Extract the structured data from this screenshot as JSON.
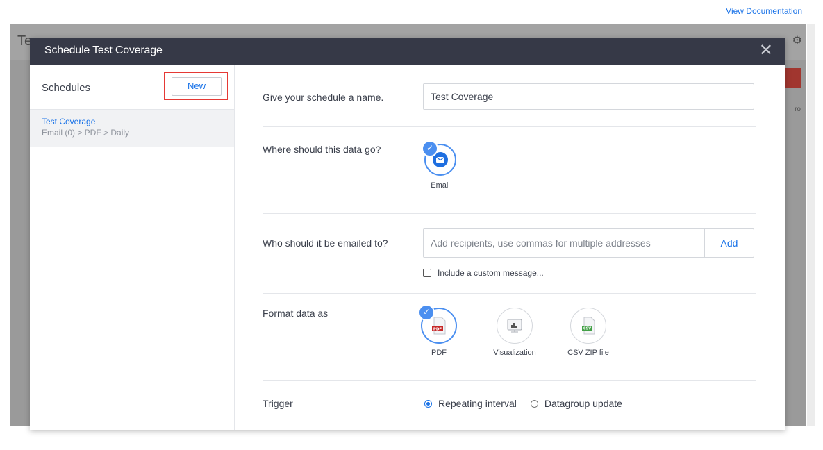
{
  "top_link": "View Documentation",
  "background": {
    "title_fragment": "Te",
    "side_fragment": "ro"
  },
  "modal": {
    "title": "Schedule Test Coverage",
    "close_symbol": "✕"
  },
  "sidebar": {
    "title": "Schedules",
    "new_button": "New",
    "schedules": [
      {
        "name": "Test Coverage",
        "path": "Email (0) > PDF > Daily"
      }
    ]
  },
  "form": {
    "name": {
      "label": "Give your schedule a name.",
      "value": "Test Coverage"
    },
    "destination": {
      "label": "Where should this data go?",
      "options": [
        {
          "label": "Email",
          "icon": "email-icon",
          "selected": true
        }
      ]
    },
    "recipients": {
      "label": "Who should it be emailed to?",
      "placeholder": "Add recipients, use commas for multiple addresses",
      "add_button": "Add",
      "custom_message": "Include a custom message..."
    },
    "format": {
      "label": "Format data as",
      "options": [
        {
          "label": "PDF",
          "icon": "pdf-file-icon",
          "selected": true
        },
        {
          "label": "Visualization",
          "icon": "visualization-icon",
          "selected": false
        },
        {
          "label": "CSV ZIP file",
          "icon": "csv-file-icon",
          "selected": false
        }
      ]
    },
    "trigger": {
      "label": "Trigger",
      "options": [
        {
          "label": "Repeating interval",
          "checked": true
        },
        {
          "label": "Datagroup update",
          "checked": false
        }
      ]
    }
  },
  "colors": {
    "header_bg": "#363947",
    "accent_blue": "#4b8ff0",
    "link_blue": "#1a73e8",
    "highlight_red": "#e53935",
    "pdf_red": "#c62828",
    "csv_green": "#43a047"
  }
}
